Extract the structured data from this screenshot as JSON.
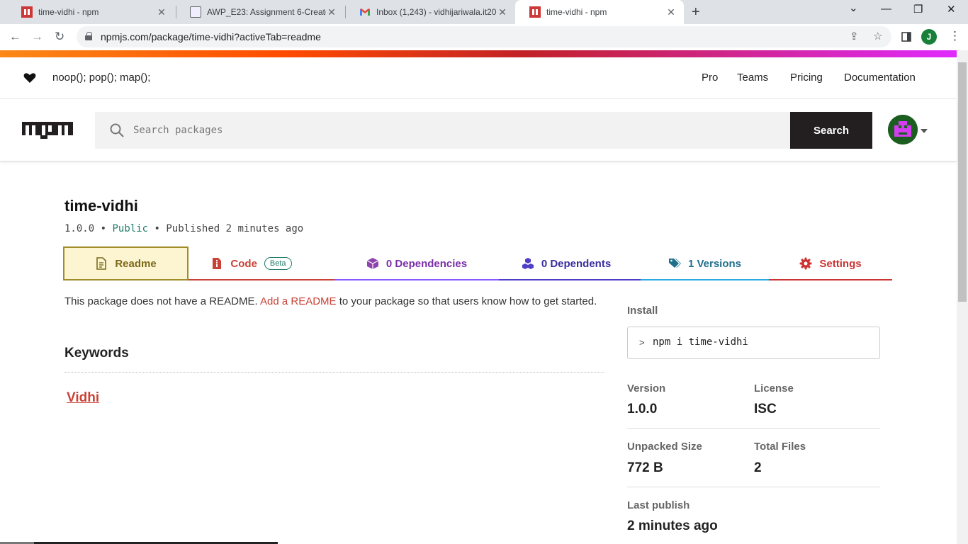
{
  "browser": {
    "tabs": [
      {
        "title": "time-vidhi - npm",
        "icon": "npm-icon"
      },
      {
        "title": "AWP_E23: Assignment 6-Create a",
        "icon": "moodle-icon"
      },
      {
        "title": "Inbox (1,243) - vidhijariwala.it20",
        "icon": "gmail-icon"
      },
      {
        "title": "time-vidhi - npm",
        "icon": "npm-icon",
        "active": true
      }
    ],
    "url": "npmjs.com/package/time-vidhi?activeTab=readme",
    "profile_initial": "J",
    "new_tab": "+",
    "back": "←",
    "forward": "→",
    "reload": "↻",
    "tab_close": "✕",
    "win_dropdown": "⌄",
    "win_minimize": "—",
    "win_restore": "❐",
    "win_close": "✕",
    "share": "⇪",
    "star": "☆",
    "menu": "⋮"
  },
  "top_nav": {
    "tagline": "noop(); pop(); map();",
    "links": [
      "Pro",
      "Teams",
      "Pricing",
      "Documentation"
    ]
  },
  "search": {
    "placeholder": "Search packages",
    "button": "Search"
  },
  "package": {
    "name": "time-vidhi",
    "version": "1.0.0",
    "separator": "•",
    "visibility": "Public",
    "published": "Published 2 minutes ago"
  },
  "tabs": {
    "readme": "Readme",
    "code": "Code",
    "code_badge": "Beta",
    "dependencies": "0 Dependencies",
    "dependents": "0 Dependents",
    "versions": "1 Versions",
    "settings": "Settings"
  },
  "readme": {
    "message_before": "This package does not have a README.",
    "link": "Add a README",
    "message_after": "to your package so that users know how to get started."
  },
  "keywords": {
    "heading": "Keywords",
    "items": [
      "Vidhi"
    ]
  },
  "sidebar": {
    "install_label": "Install",
    "install_prompt": ">",
    "install_cmd": "npm i time-vidhi",
    "version_label": "Version",
    "version_value": "1.0.0",
    "license_label": "License",
    "license_value": "ISC",
    "unpacked_label": "Unpacked Size",
    "unpacked_value": "772 B",
    "files_label": "Total Files",
    "files_value": "2",
    "last_publish_label": "Last publish",
    "last_publish_value": "2 minutes ago"
  },
  "colors": {
    "npm_red": "#cb3837",
    "readme_tab": "#a08c28",
    "code_tab": "#c94237",
    "deps_tab": "#8956ff",
    "dependents_tab": "#4f3fc7",
    "versions_tab": "#29abe0",
    "settings_tab": "#cc3333"
  }
}
